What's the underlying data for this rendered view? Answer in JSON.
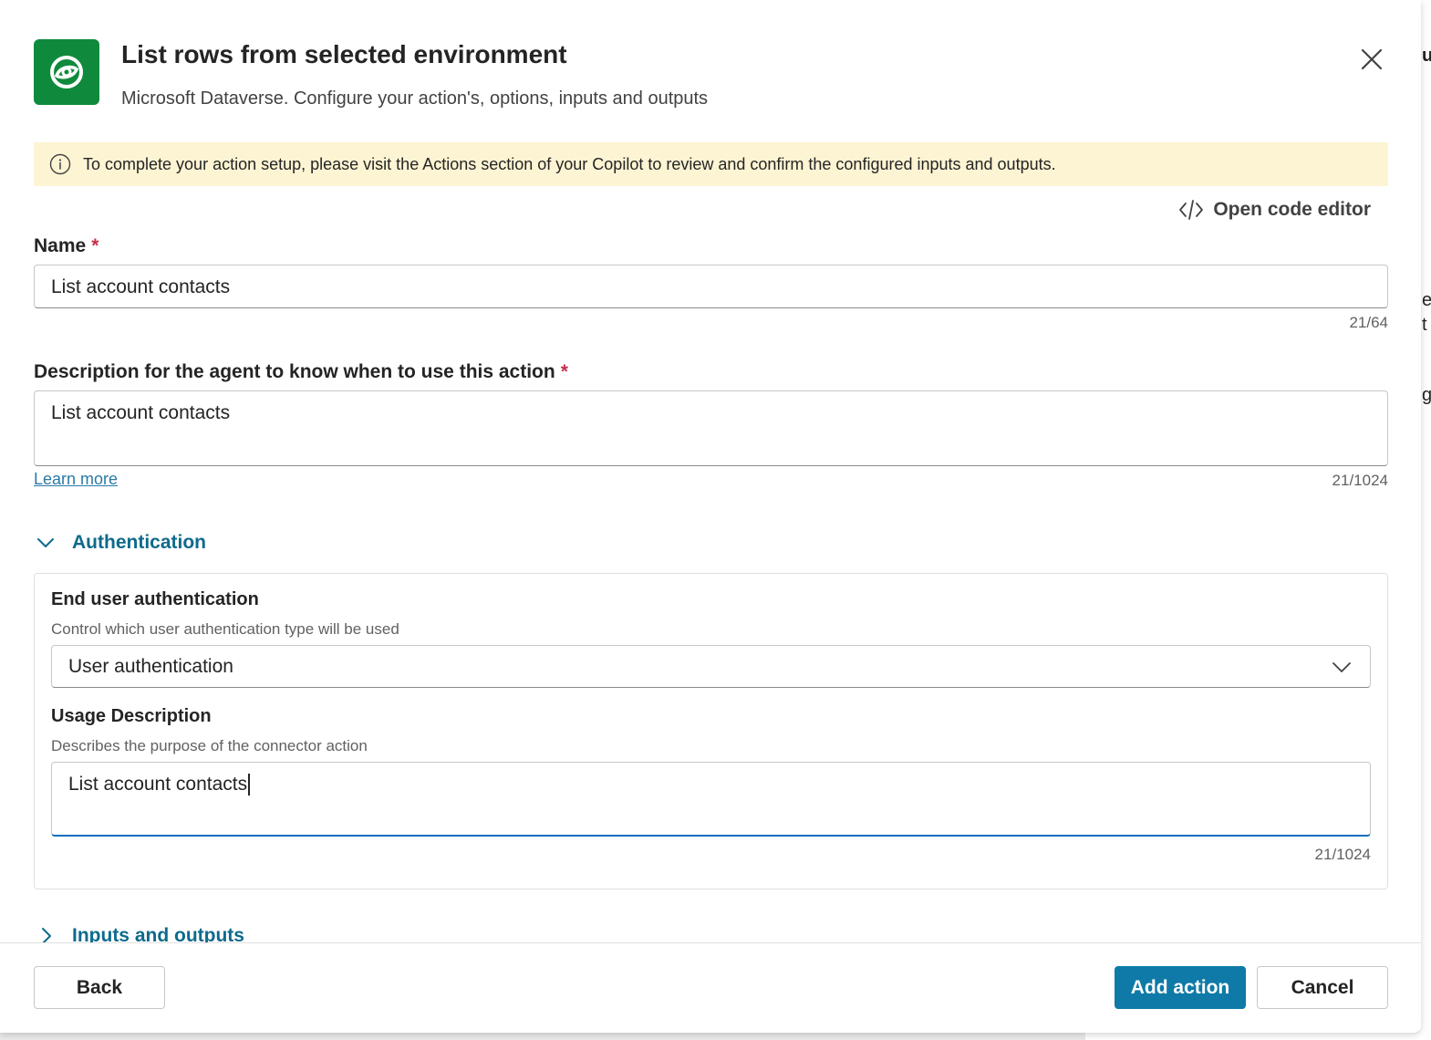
{
  "header": {
    "title": "List rows from selected environment",
    "subtitle": "Microsoft Dataverse. Configure your action's, options, inputs and outputs"
  },
  "banner": {
    "text": "To complete your action setup, please visit the Actions section of your Copilot to review and confirm the configured inputs and outputs."
  },
  "toolbar": {
    "code_editor_label": "Open code editor"
  },
  "name_field": {
    "label": "Name",
    "required_mark": "*",
    "value": "List account contacts",
    "counter": "21/64"
  },
  "description_field": {
    "label": "Description for the agent to know when to use this action",
    "required_mark": "*",
    "value": "List account contacts",
    "counter": "21/1024",
    "learn_more": "Learn more"
  },
  "authentication": {
    "section_label": "Authentication",
    "expanded": true,
    "end_user_label": "End user authentication",
    "end_user_hint": "Control which user authentication type will be used",
    "selected": "User authentication",
    "usage_label": "Usage Description",
    "usage_hint": "Describes the purpose of the connector action",
    "usage_value": "List account contacts",
    "usage_counter": "21/1024"
  },
  "inputs_outputs": {
    "section_label": "Inputs and outputs",
    "expanded": false
  },
  "footer": {
    "back_label": "Back",
    "add_label": "Add action",
    "cancel_label": "Cancel"
  },
  "colors": {
    "logo_bg": "#0f8a3c",
    "banner_bg": "#fdf4d3",
    "primary": "#0f7aa8",
    "link": "#0e6a8c",
    "required": "#c4314b"
  },
  "icons": [
    "dataverse-logo-icon",
    "close-icon",
    "info-icon",
    "code-icon",
    "chevron-down-icon",
    "chevron-right-icon"
  ]
}
